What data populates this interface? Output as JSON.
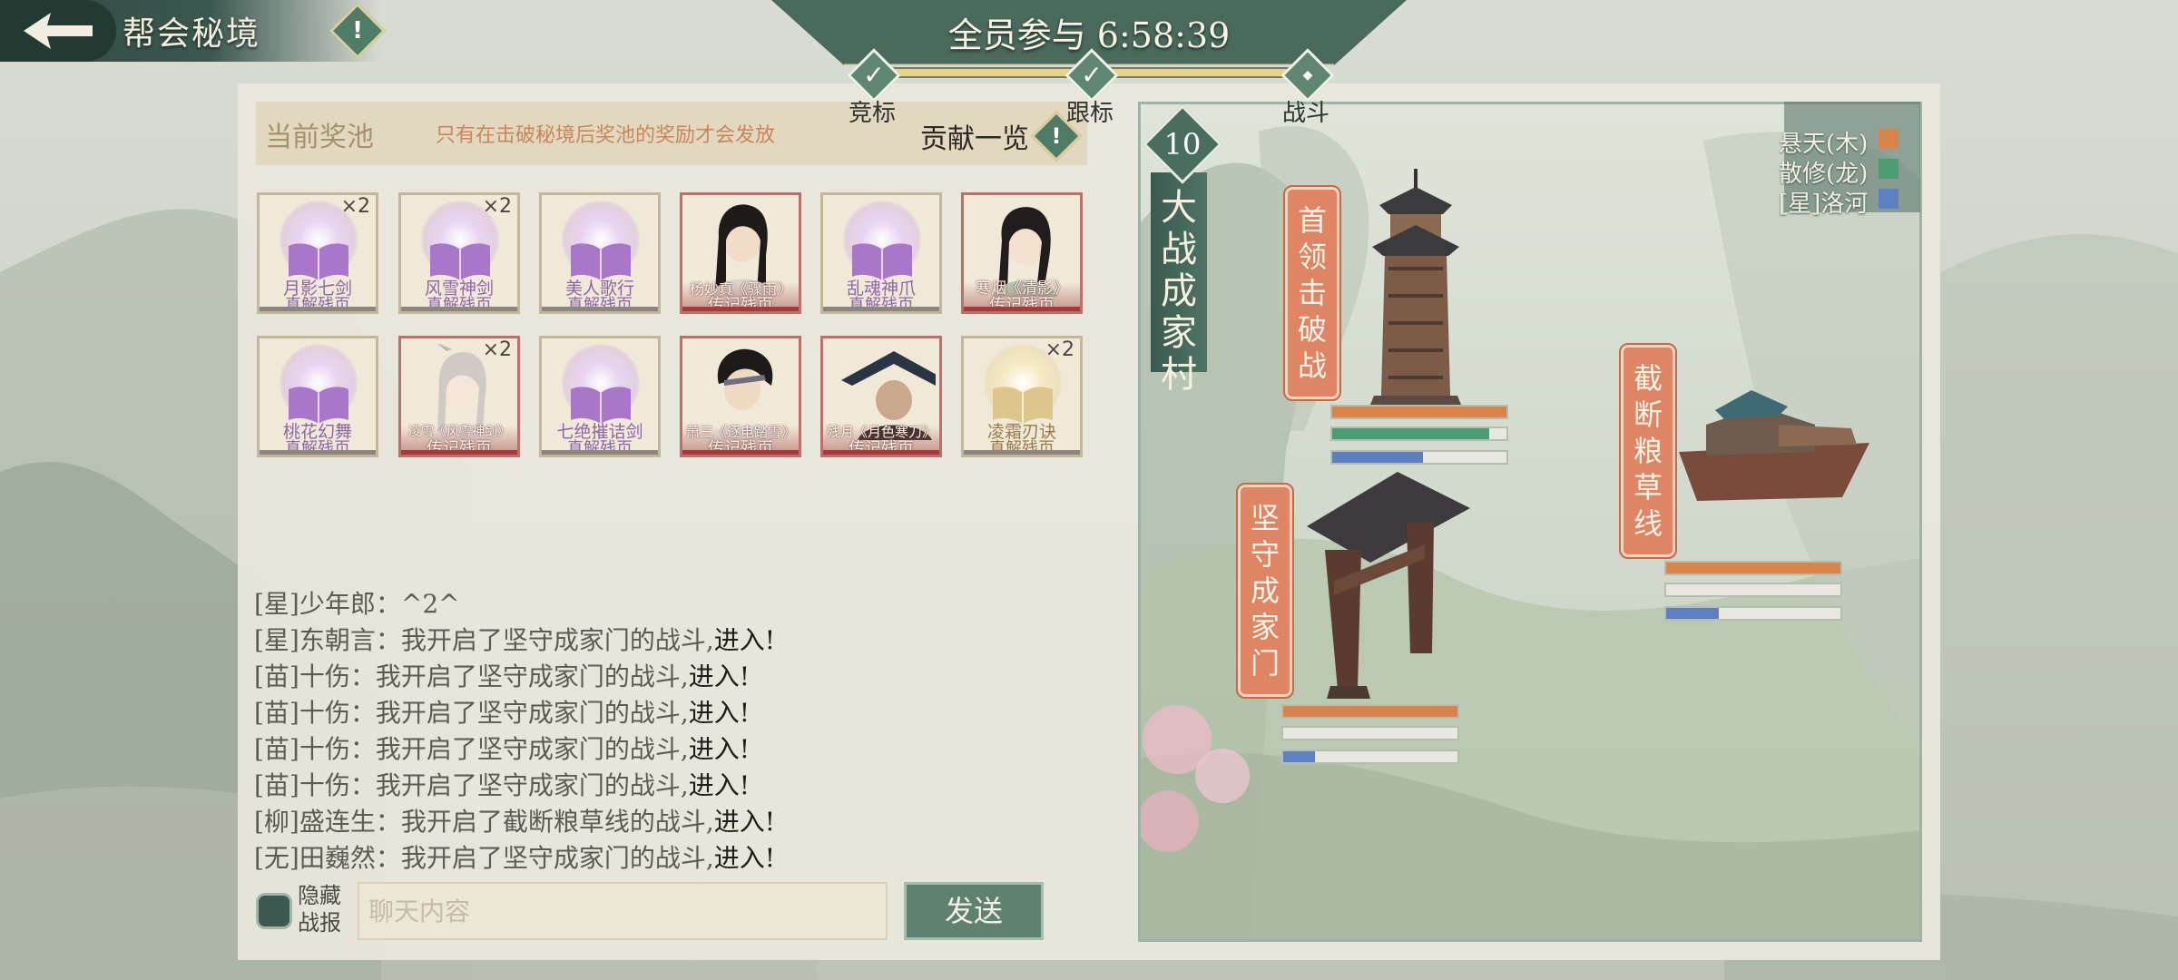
{
  "header": {
    "title": "帮会秘境",
    "timer_text": "全员参与 6:58:39"
  },
  "stages": [
    {
      "label": "竞标",
      "state": "done"
    },
    {
      "label": "跟标",
      "state": "done"
    },
    {
      "label": "战斗",
      "state": "current"
    }
  ],
  "pool": {
    "title": "当前奖池",
    "note": "只有在击破秘境后奖池的奖励才会发放",
    "contribution_label": "贡献一览"
  },
  "rewards": [
    {
      "name": "月影七剑",
      "sub": "真解残页",
      "kind": "book",
      "qty": "×2"
    },
    {
      "name": "风雪神剑",
      "sub": "真解残页",
      "kind": "book",
      "qty": "×2"
    },
    {
      "name": "美人歌行",
      "sub": "真解残页",
      "kind": "book",
      "qty": ""
    },
    {
      "name": "杨妙真《骤雨》",
      "sub": "传记残页",
      "kind": "portrait",
      "qty": ""
    },
    {
      "name": "乱魂神爪",
      "sub": "真解残页",
      "kind": "book",
      "qty": ""
    },
    {
      "name": "寒烟《清影》",
      "sub": "传记残页",
      "kind": "portrait",
      "qty": ""
    },
    {
      "name": "桃花幻舞",
      "sub": "真解残页",
      "kind": "book",
      "qty": ""
    },
    {
      "name": "凌雪《风雪神剑》",
      "sub": "传记残页",
      "kind": "portrait",
      "qty": "×2"
    },
    {
      "name": "七绝摧诘剑",
      "sub": "真解残页",
      "kind": "book",
      "qty": ""
    },
    {
      "name": "萧三《逐电踏雪》",
      "sub": "传记残页",
      "kind": "portrait",
      "qty": ""
    },
    {
      "name": "残月《月色寒刀》",
      "sub": "传记残页",
      "kind": "portrait",
      "qty": ""
    },
    {
      "name": "凌霜刃诀",
      "sub": "真解残页",
      "kind": "gold",
      "qty": "×2"
    }
  ],
  "chat": [
    {
      "speaker": "[星]少年郎：",
      "text": "^2^",
      "link": ""
    },
    {
      "speaker": "[星]东朝言：",
      "text": "我开启了坚守成家门的战斗,",
      "link": "进入!"
    },
    {
      "speaker": "[苗]十伤：",
      "text": "我开启了坚守成家门的战斗,",
      "link": "进入!"
    },
    {
      "speaker": "[苗]十伤：",
      "text": "我开启了坚守成家门的战斗,",
      "link": "进入!"
    },
    {
      "speaker": "[苗]十伤：",
      "text": "我开启了坚守成家门的战斗,",
      "link": "进入!"
    },
    {
      "speaker": "[苗]十伤：",
      "text": "我开启了坚守成家门的战斗,",
      "link": "进入!"
    },
    {
      "speaker": "[柳]盛连生：",
      "text": "我开启了截断粮草线的战斗,",
      "link": "进入!"
    },
    {
      "speaker": "[无]田巍然：",
      "text": "我开启了坚守成家门的战斗,",
      "link": "进入!"
    }
  ],
  "chat_controls": {
    "hide_label": "隐藏战报",
    "input_placeholder": "聊天内容",
    "send_label": "发送"
  },
  "map": {
    "level": "10",
    "title": "大战成家村",
    "legend": [
      {
        "name": "悬天(木)",
        "color": "#d9844b"
      },
      {
        "name": "散修(龙)",
        "color": "#4e9c74"
      },
      {
        "name": "[星]洛河",
        "color": "#5b7fc0"
      }
    ],
    "battles": [
      {
        "name": "首领击破战",
        "progress": [
          1.0,
          0.9,
          0.52
        ]
      },
      {
        "name": "截断粮草线",
        "progress": [
          1.0,
          0.0,
          0.3
        ]
      },
      {
        "name": "坚守成家门",
        "progress": [
          1.0,
          0.0,
          0.18
        ]
      }
    ]
  }
}
